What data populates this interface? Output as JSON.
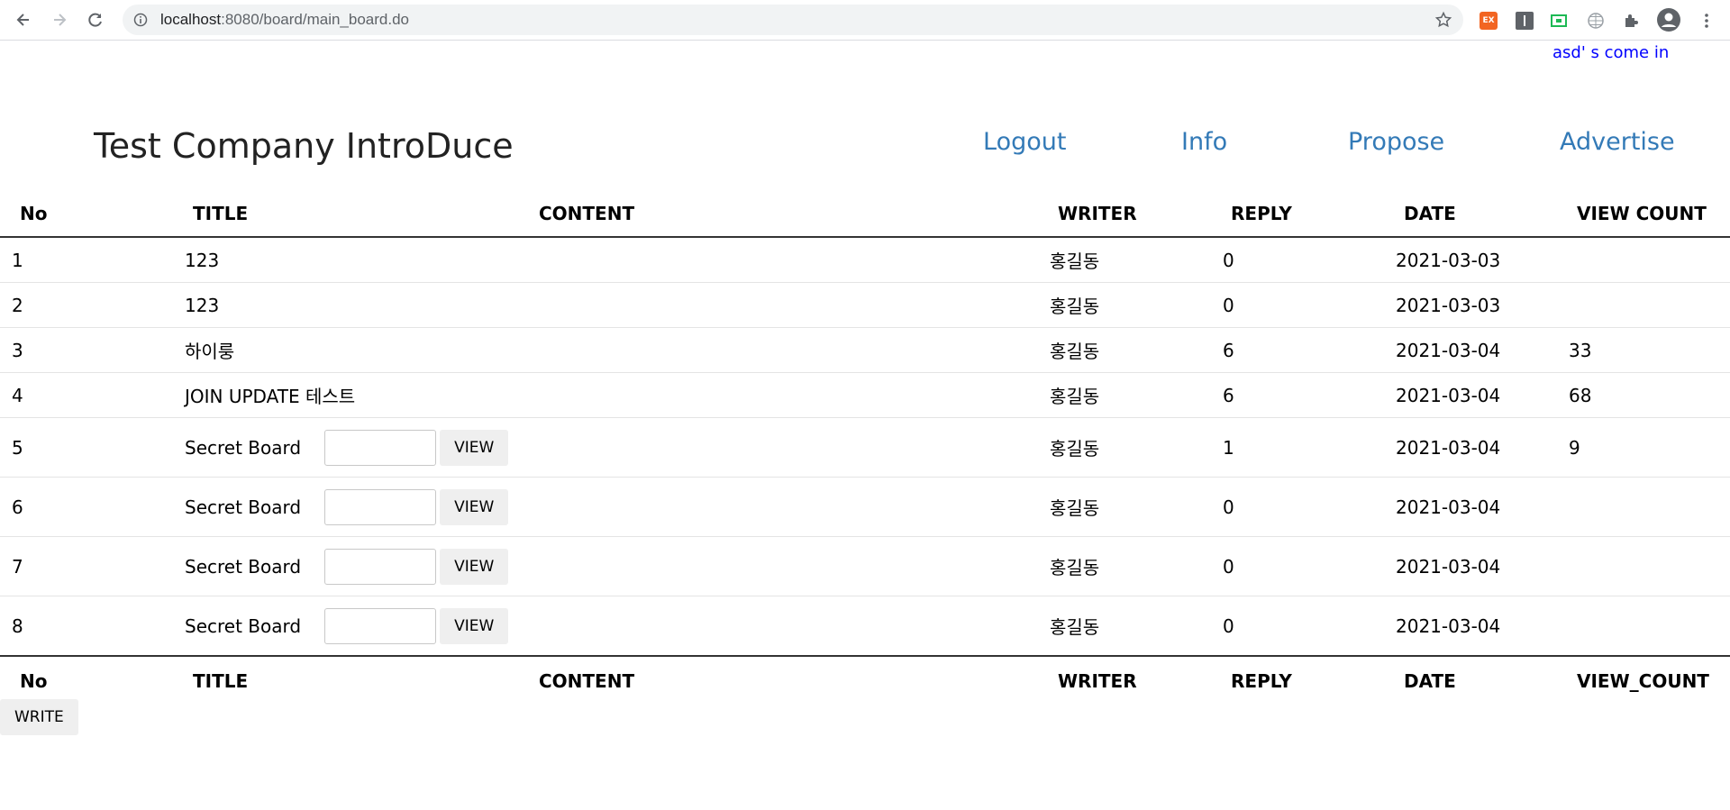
{
  "browser": {
    "url_host": "localhost",
    "url_rest": ":8080/board/main_board.do"
  },
  "welcome": "asd' s come in",
  "company": "Test Company IntroDuce",
  "menu": [
    "Logout",
    "Info",
    "Propose",
    "Advertise"
  ],
  "header": [
    "No",
    "TITLE",
    "CONTENT",
    "WRITER",
    "REPLY",
    "DATE",
    "VIEW COUNT"
  ],
  "footer": [
    "No",
    "TITLE",
    "CONTENT",
    "WRITER",
    "REPLY",
    "DATE",
    "VIEW_COUNT"
  ],
  "rows": [
    {
      "no": "1",
      "title": "123",
      "content": "",
      "writer": "홍길동",
      "reply": "0",
      "date": "2021-03-03",
      "view": ""
    },
    {
      "no": "2",
      "title": "123",
      "content": "",
      "writer": "홍길동",
      "reply": "0",
      "date": "2021-03-03",
      "view": ""
    },
    {
      "no": "3",
      "title": "하이룽",
      "content": "",
      "writer": "홍길동",
      "reply": "6",
      "date": "2021-03-04",
      "view": "33"
    },
    {
      "no": "4",
      "title": "JOIN UPDATE 테스트",
      "content": "",
      "writer": "홍길동",
      "reply": "6",
      "date": "2021-03-04",
      "view": "68"
    },
    {
      "no": "5",
      "title": "Secret Board",
      "content": "",
      "writer": "홍길동",
      "reply": "1",
      "date": "2021-03-04",
      "view": "9"
    },
    {
      "no": "6",
      "title": "Secret Board",
      "content": "",
      "writer": "홍길동",
      "reply": "0",
      "date": "2021-03-04",
      "view": ""
    },
    {
      "no": "7",
      "title": "Secret Board",
      "content": "",
      "writer": "홍길동",
      "reply": "0",
      "date": "2021-03-04",
      "view": ""
    },
    {
      "no": "8",
      "title": "Secret Board",
      "content": "",
      "writer": "홍길동",
      "reply": "0",
      "date": "2021-03-04",
      "view": ""
    }
  ],
  "view_button": "VIEW",
  "write_button": "WRITE",
  "colors": {
    "link": "#337ab7",
    "welcome": "#0000ff",
    "button_bg": "#efefef"
  }
}
